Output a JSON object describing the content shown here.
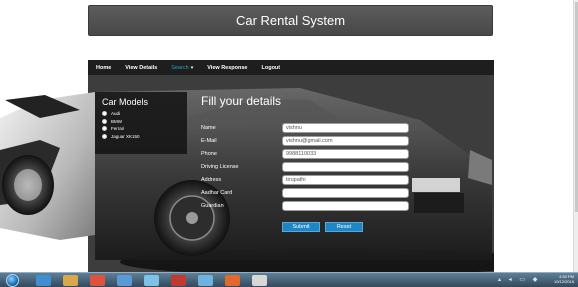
{
  "header": {
    "title": "Car Rental System"
  },
  "nav": {
    "items": [
      {
        "label": "Home"
      },
      {
        "label": "View Details"
      },
      {
        "label": "Search"
      },
      {
        "label": "View Response"
      },
      {
        "label": "Logout"
      }
    ]
  },
  "models": {
    "title": "Car Models",
    "items": [
      {
        "label": "Audi"
      },
      {
        "label": "BMW"
      },
      {
        "label": "Ferrari"
      },
      {
        "label": "Jaguar XK150"
      }
    ]
  },
  "form": {
    "title": "Fill your details",
    "fields": [
      {
        "label": "Name",
        "value": "vishnu"
      },
      {
        "label": "E-Mail",
        "value": "vishnu@gmail.com"
      },
      {
        "label": "Phone",
        "value": "9988110033"
      },
      {
        "label": "Driving License",
        "value": ""
      },
      {
        "label": "Address",
        "value": "tirupathi"
      },
      {
        "label": "Aadhar Card",
        "value": ""
      },
      {
        "label": "Guardian",
        "value": ""
      }
    ],
    "submit_label": "Submit",
    "reset_label": "Reset"
  },
  "taskbar": {
    "time": "4:30 PM",
    "date": "10/12/2016"
  },
  "colors": {
    "header_bg": "#4f4f4f",
    "panel_bg": "#3d3d3d",
    "menubar_bg": "#1e1e1e",
    "accent": "#2aa4c8",
    "button": "#1f86c4"
  }
}
